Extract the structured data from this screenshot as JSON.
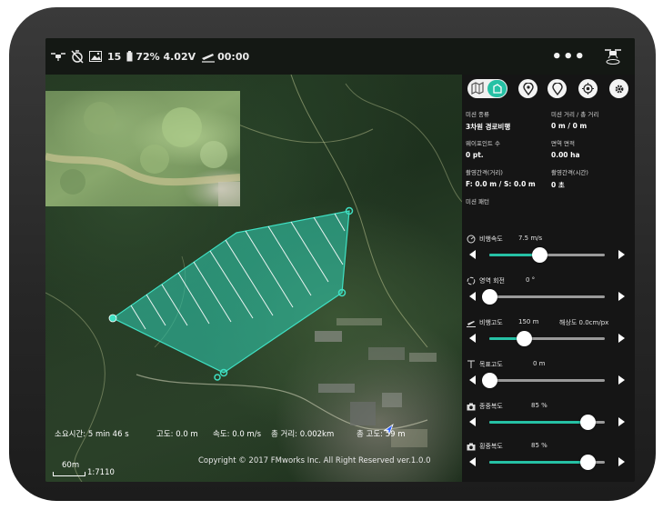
{
  "status_bar": {
    "photo_count": "15",
    "battery": "72% 4.02V",
    "flight_time": "00:00",
    "more_label": "•••"
  },
  "map": {
    "stats": {
      "duration": "소요시간: 5 min 46 s",
      "altitude": "고도: 0.0 m",
      "speed": "속도: 0.0 m/s",
      "total_distance": "총 거리: 0.002km",
      "total_altitude": "총 고도: 59 m"
    },
    "copyright": "Copyright © 2017 FMworks Inc. All Right Reserved ver.1.0.0",
    "scale_distance": "60m",
    "scale_ratio": "1:7110"
  },
  "panel": {
    "colors": {
      "accent": "#26c1a5",
      "polygon": "#2ec4a8"
    },
    "info": {
      "mission_type_label": "미션 종류",
      "mission_type_value": "3차원 경로비행",
      "mission_distance_label": "미션 거리 / 총 거리",
      "mission_distance_value": "0 m / 0 m",
      "waypoint_count_label": "웨이포인트 수",
      "waypoint_count_value": "0 pt.",
      "area_label": "면역 면적",
      "area_value": "0.00 ha",
      "interval_distance_label": "촬영간격(거리)",
      "interval_distance_value": "F: 0.0 m / S: 0.0 m",
      "interval_time_label": "촬영간격(시간)",
      "interval_time_value": "0 초",
      "mission_pattern_label": "미션 패턴"
    },
    "sliders": [
      {
        "label": "비행속도",
        "value": "7.5 m/s",
        "extra": "",
        "fraction": 0.43,
        "icon": "speedometer-icon"
      },
      {
        "label": "영역 회전",
        "value": "0 °",
        "extra": "",
        "fraction": 0.0,
        "icon": "rotate-icon"
      },
      {
        "label": "비행고도",
        "value": "150 m",
        "extra": "해상도   0.0cm/px",
        "fraction": 0.3,
        "icon": "plane-altitude-icon"
      },
      {
        "label": "목표고도",
        "value": "0 m",
        "extra": "",
        "fraction": 0.0,
        "icon": "target-altitude-icon"
      },
      {
        "label": "종중복도",
        "value": "85 %",
        "extra": "",
        "fraction": 0.85,
        "icon": "camera-icon"
      },
      {
        "label": "횡중복도",
        "value": "85 %",
        "extra": "",
        "fraction": 0.85,
        "icon": "camera-icon"
      }
    ]
  }
}
